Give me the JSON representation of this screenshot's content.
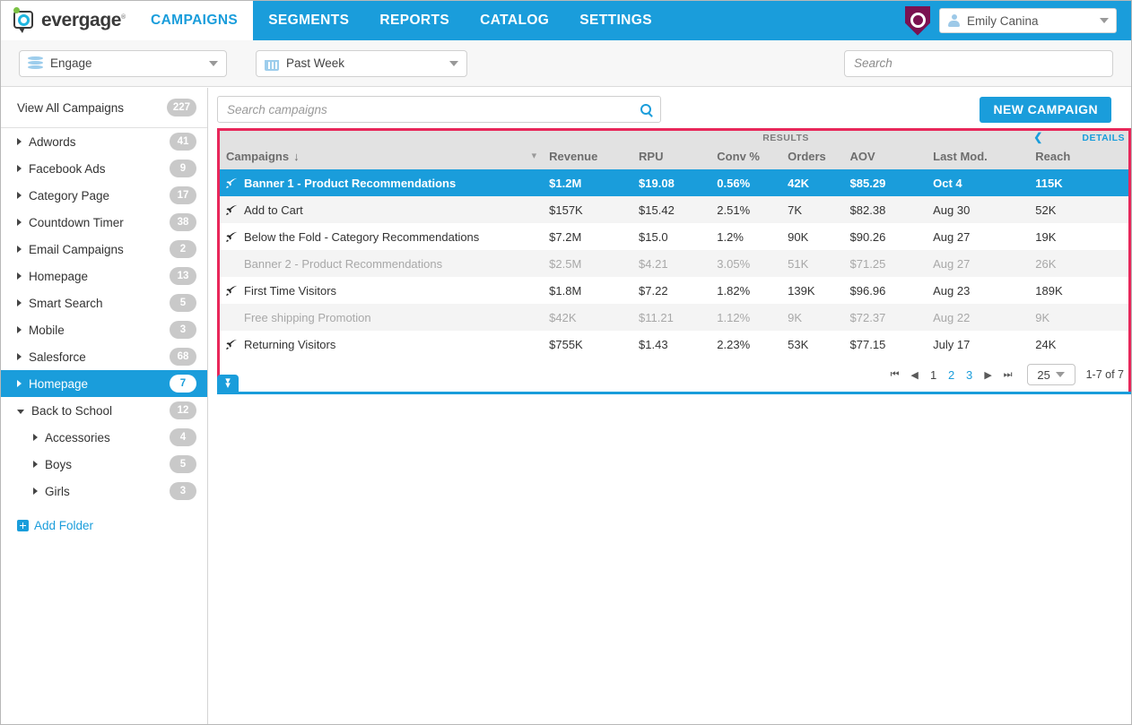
{
  "brand": {
    "name": "evergage",
    "tm": "®",
    "accent": "#1a9ddb",
    "highlight": "#e8275a"
  },
  "topnav": {
    "tabs": [
      {
        "label": "CAMPAIGNS",
        "active": true
      },
      {
        "label": "SEGMENTS",
        "active": false
      },
      {
        "label": "REPORTS",
        "active": false
      },
      {
        "label": "CATALOG",
        "active": false
      },
      {
        "label": "SETTINGS",
        "active": false
      }
    ],
    "user": "Emily Canina"
  },
  "toolbar": {
    "dataset": "Engage",
    "period": "Past Week",
    "search_placeholder": "Search",
    "search_value": ""
  },
  "sidebar": {
    "view_all": {
      "label": "View All Campaigns",
      "count": "227"
    },
    "folders": [
      {
        "label": "Adwords",
        "count": "41",
        "expanded": false,
        "indent": 0,
        "selected": false
      },
      {
        "label": "Facebook Ads",
        "count": "9",
        "expanded": false,
        "indent": 0,
        "selected": false
      },
      {
        "label": "Category Page",
        "count": "17",
        "expanded": false,
        "indent": 0,
        "selected": false
      },
      {
        "label": "Countdown Timer",
        "count": "38",
        "expanded": false,
        "indent": 0,
        "selected": false
      },
      {
        "label": "Email Campaigns",
        "count": "2",
        "expanded": false,
        "indent": 0,
        "selected": false
      },
      {
        "label": "Homepage",
        "count": "13",
        "expanded": false,
        "indent": 0,
        "selected": false
      },
      {
        "label": "Smart Search",
        "count": "5",
        "expanded": false,
        "indent": 0,
        "selected": false
      },
      {
        "label": "Mobile",
        "count": "3",
        "expanded": false,
        "indent": 0,
        "selected": false
      },
      {
        "label": "Salesforce",
        "count": "68",
        "expanded": false,
        "indent": 0,
        "selected": false
      },
      {
        "label": "Homepage",
        "count": "7",
        "expanded": false,
        "indent": 0,
        "selected": true
      },
      {
        "label": "Back to School",
        "count": "12",
        "expanded": true,
        "indent": 0,
        "selected": false
      },
      {
        "label": "Accessories",
        "count": "4",
        "expanded": false,
        "indent": 1,
        "selected": false
      },
      {
        "label": "Boys",
        "count": "5",
        "expanded": false,
        "indent": 1,
        "selected": false
      },
      {
        "label": "Girls",
        "count": "3",
        "expanded": false,
        "indent": 1,
        "selected": false
      }
    ],
    "add_folder": "Add Folder"
  },
  "main": {
    "search_placeholder": "Search campaigns",
    "search_value": "",
    "new_campaign": "NEW CAMPAIGN",
    "group_header": "RESULTS",
    "details_label": "DETAILS",
    "columns": [
      {
        "key": "campaign",
        "label": "Campaigns"
      },
      {
        "key": "revenue",
        "label": "Revenue"
      },
      {
        "key": "rpu",
        "label": "RPU"
      },
      {
        "key": "conv",
        "label": "Conv %"
      },
      {
        "key": "orders",
        "label": "Orders"
      },
      {
        "key": "aov",
        "label": "AOV"
      },
      {
        "key": "lastmod",
        "label": "Last Mod."
      },
      {
        "key": "reach",
        "label": "Reach"
      }
    ],
    "sort_indicator": "↓",
    "rows": [
      {
        "campaign": "Banner 1 -  Product Recommendations",
        "revenue": "$1.2M",
        "rpu": "$19.08",
        "conv": "0.56%",
        "orders": "42K",
        "aov": "$85.29",
        "lastmod": "Oct  4",
        "reach": "115K",
        "icon": "rocket-icon",
        "state": "selected"
      },
      {
        "campaign": "Add to Cart",
        "revenue": "$157K",
        "rpu": "$15.42",
        "conv": "2.51%",
        "orders": "7K",
        "aov": "$82.38",
        "lastmod": "Aug 30",
        "reach": "52K",
        "icon": "rocket-icon",
        "state": "alt"
      },
      {
        "campaign": "Below the Fold - Category Recommendations",
        "revenue": "$7.2M",
        "rpu": "$15.0",
        "conv": "1.2%",
        "orders": "90K",
        "aov": "$90.26",
        "lastmod": "Aug 27",
        "reach": "19K",
        "icon": "rocket-icon",
        "state": "normal"
      },
      {
        "campaign": "Banner 2 - Product Recommendations",
        "revenue": "$2.5M",
        "rpu": "$4.21",
        "conv": "3.05%",
        "orders": "51K",
        "aov": "$71.25",
        "lastmod": "Aug 27",
        "reach": "26K",
        "icon": "none",
        "state": "dim"
      },
      {
        "campaign": "First Time Visitors",
        "revenue": "$1.8M",
        "rpu": "$7.22",
        "conv": "1.82%",
        "orders": "139K",
        "aov": "$96.96",
        "lastmod": "Aug 23",
        "reach": "189K",
        "icon": "rocket-icon",
        "state": "normal"
      },
      {
        "campaign": "Free shipping Promotion",
        "revenue": "$42K",
        "rpu": "$11.21",
        "conv": "1.12%",
        "orders": "9K",
        "aov": "$72.37",
        "lastmod": "Aug 22",
        "reach": "9K",
        "icon": "none",
        "state": "dim"
      },
      {
        "campaign": "Returning Visitors",
        "revenue": "$755K",
        "rpu": "$1.43",
        "conv": "2.23%",
        "orders": "53K",
        "aov": "$77.15",
        "lastmod": "July 17",
        "reach": "24K",
        "icon": "rocket-icon",
        "state": "normal"
      }
    ],
    "pagination": {
      "first": "⏮",
      "prev": "◀",
      "next": "▶",
      "last": "⏭",
      "pages": [
        {
          "label": "1",
          "current": true
        },
        {
          "label": "2",
          "current": false
        },
        {
          "label": "3",
          "current": false
        }
      ],
      "page_size": "25",
      "range": "1-7 of 7"
    }
  }
}
